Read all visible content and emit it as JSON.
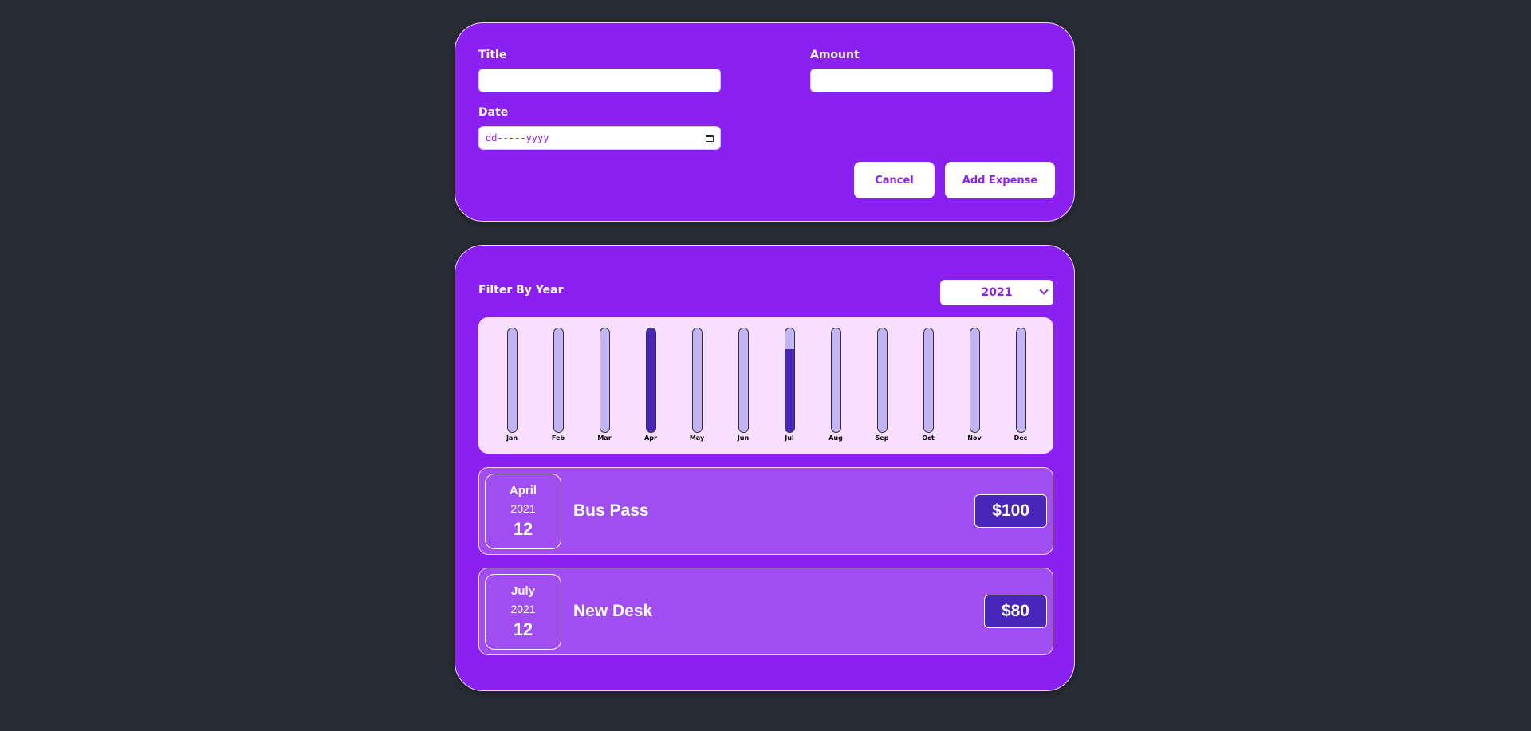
{
  "form": {
    "title_label": "Title",
    "amount_label": "Amount",
    "date_label": "Date",
    "title_value": "",
    "amount_value": "",
    "date_placeholder": "dd-----yyyy",
    "cancel_label": "Cancel",
    "add_label": "Add Expense"
  },
  "filter": {
    "label": "Filter By Year",
    "selected_year": "2021"
  },
  "chart_data": {
    "type": "bar",
    "categories": [
      "Jan",
      "Feb",
      "Mar",
      "Apr",
      "May",
      "Jun",
      "Jul",
      "Aug",
      "Sep",
      "Oct",
      "Nov",
      "Dec"
    ],
    "values": [
      0,
      0,
      0,
      100,
      0,
      0,
      80,
      0,
      0,
      0,
      0,
      0
    ],
    "ylim": [
      0,
      100
    ]
  },
  "expenses": [
    {
      "month": "April",
      "year": "2021",
      "day": "12",
      "title": "Bus Pass",
      "amount": "$100"
    },
    {
      "month": "July",
      "year": "2021",
      "day": "12",
      "title": "New Desk",
      "amount": "$80"
    }
  ],
  "colors": {
    "background": "#282c34",
    "card": "#8b21f0",
    "item": "#a04df2",
    "bar_fill": "#4826b9",
    "bar_track": "#c3b4f3",
    "chart_bg": "#f8dfff"
  }
}
